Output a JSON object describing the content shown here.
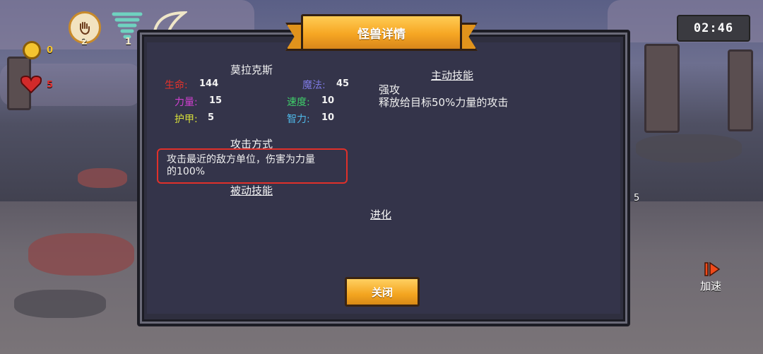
{
  "hud": {
    "skill_count_1": "2",
    "skill_count_2": "1",
    "gold": "0",
    "lives": "5",
    "timer": "02:46",
    "side_count": "5",
    "speed_label": "加速"
  },
  "panel": {
    "title": "怪兽详情",
    "monster_name": "莫拉克斯",
    "stats": [
      {
        "label": "生命:",
        "value": "144",
        "color": "#e8322a"
      },
      {
        "label": "魔法:",
        "value": "45",
        "color": "#7c78e0"
      },
      {
        "label": "力量:",
        "value": "15",
        "color": "#d040d0"
      },
      {
        "label": "速度:",
        "value": "10",
        "color": "#3fcf6a"
      },
      {
        "label": "护甲:",
        "value": "5",
        "color": "#d8e03a"
      },
      {
        "label": "智力:",
        "value": "10",
        "color": "#4fb8e8"
      }
    ],
    "attack_heading": "攻击方式",
    "attack_desc_line1": "攻击最近的敌方单位，伤害为力量",
    "attack_desc_line2": "的100%",
    "passive_heading": "被动技能",
    "active_heading": "主动技能",
    "active_skill_name": "强攻",
    "active_skill_desc": "释放给目标50%力量的攻击",
    "evolve_heading": "进化",
    "close_label": "关闭"
  }
}
